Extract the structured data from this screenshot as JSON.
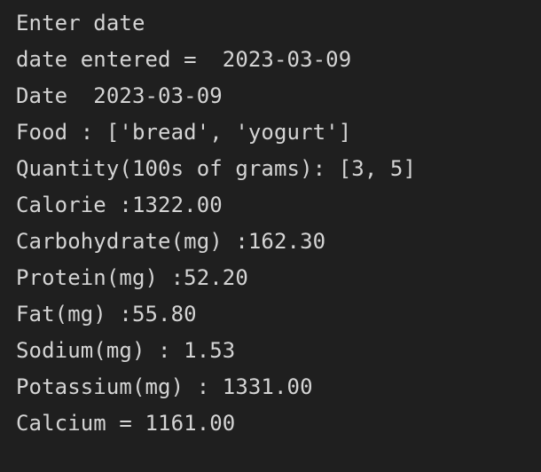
{
  "terminal": {
    "lines": [
      "Enter date",
      "date entered =  2023-03-09",
      "Date  2023-03-09",
      "Food : ['bread', 'yogurt']",
      "Quantity(100s of grams): [3, 5]",
      "Calorie :1322.00",
      "Carbohydrate(mg) :162.30",
      "Protein(mg) :52.20",
      "Fat(mg) :55.80",
      "Sodium(mg) : 1.53",
      "Potassium(mg) : 1331.00",
      "Calcium = 1161.00"
    ]
  },
  "colors": {
    "background": "#1f1f1f",
    "text": "#d4d4d4"
  }
}
